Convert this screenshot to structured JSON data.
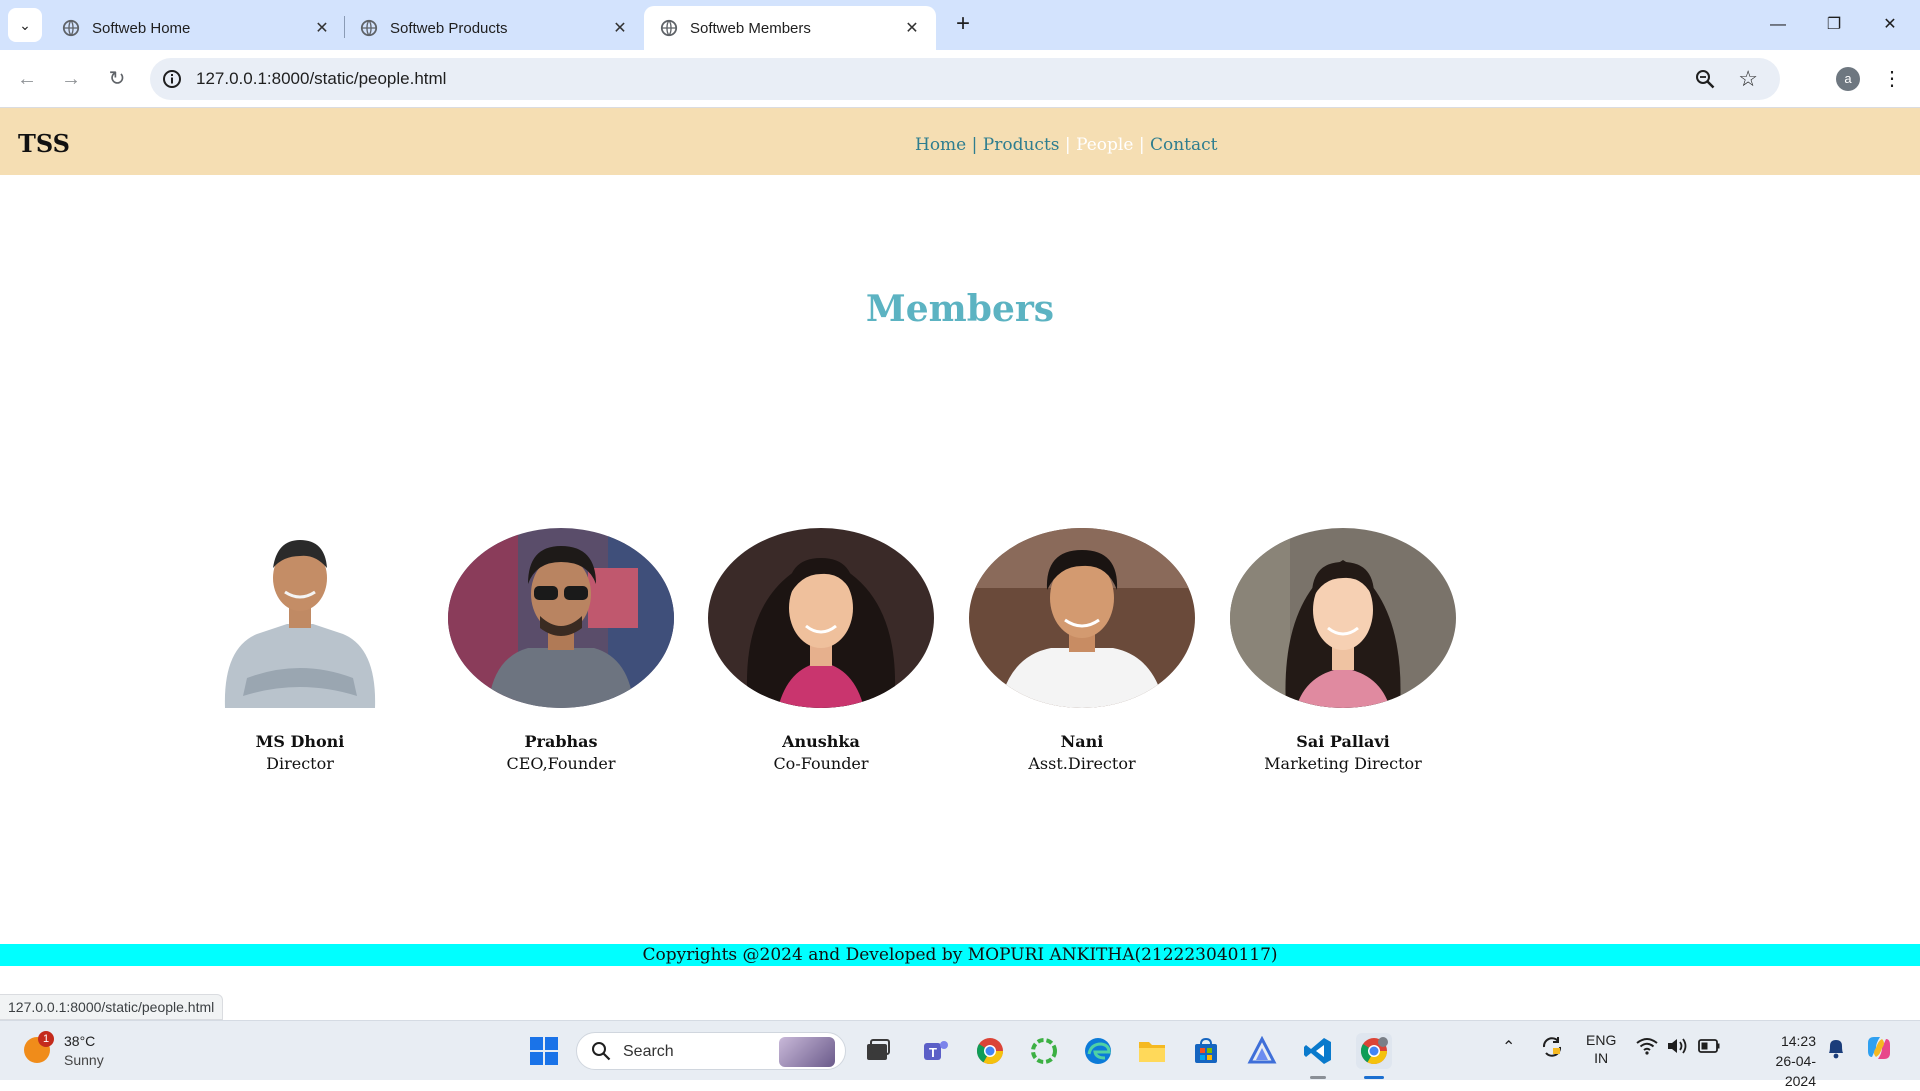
{
  "browser": {
    "tabs": [
      {
        "title": "Softweb Home",
        "active": false
      },
      {
        "title": "Softweb Products",
        "active": false
      },
      {
        "title": "Softweb Members",
        "active": true
      }
    ],
    "url": "127.0.0.1:8000/static/people.html",
    "profile_initial": "a",
    "status_url": "127.0.0.1:8000/static/people.html"
  },
  "site": {
    "logo": "TSS",
    "nav": [
      {
        "label": "Home",
        "active": false
      },
      {
        "label": "Products",
        "active": false
      },
      {
        "label": "People",
        "active": true
      },
      {
        "label": "Contact",
        "active": false
      }
    ],
    "page_title": "Members",
    "members": [
      {
        "name": "MS Dhoni",
        "role": "Director"
      },
      {
        "name": "Prabhas",
        "role": "CEO,Founder"
      },
      {
        "name": "Anushka",
        "role": "Co-Founder"
      },
      {
        "name": "Nani",
        "role": "Asst.Director"
      },
      {
        "name": "Sai Pallavi",
        "role": "Marketing Director"
      }
    ],
    "footer": "Copyrights @2024 and Developed by MOPURI ANKITHA(212223040117)"
  },
  "taskbar": {
    "weather": {
      "temp": "38°C",
      "condition": "Sunny",
      "badge": "1"
    },
    "search_label": "Search",
    "lang_top": "ENG",
    "lang_bottom": "IN",
    "time": "14:23",
    "date": "26-04-2024"
  },
  "colors": {
    "header_bg": "#f5deb3",
    "nav_link": "#2e7d8f",
    "title": "#5cb3c2",
    "footer_bg": "#00ffff",
    "tabstrip_bg": "#d3e3fd"
  }
}
